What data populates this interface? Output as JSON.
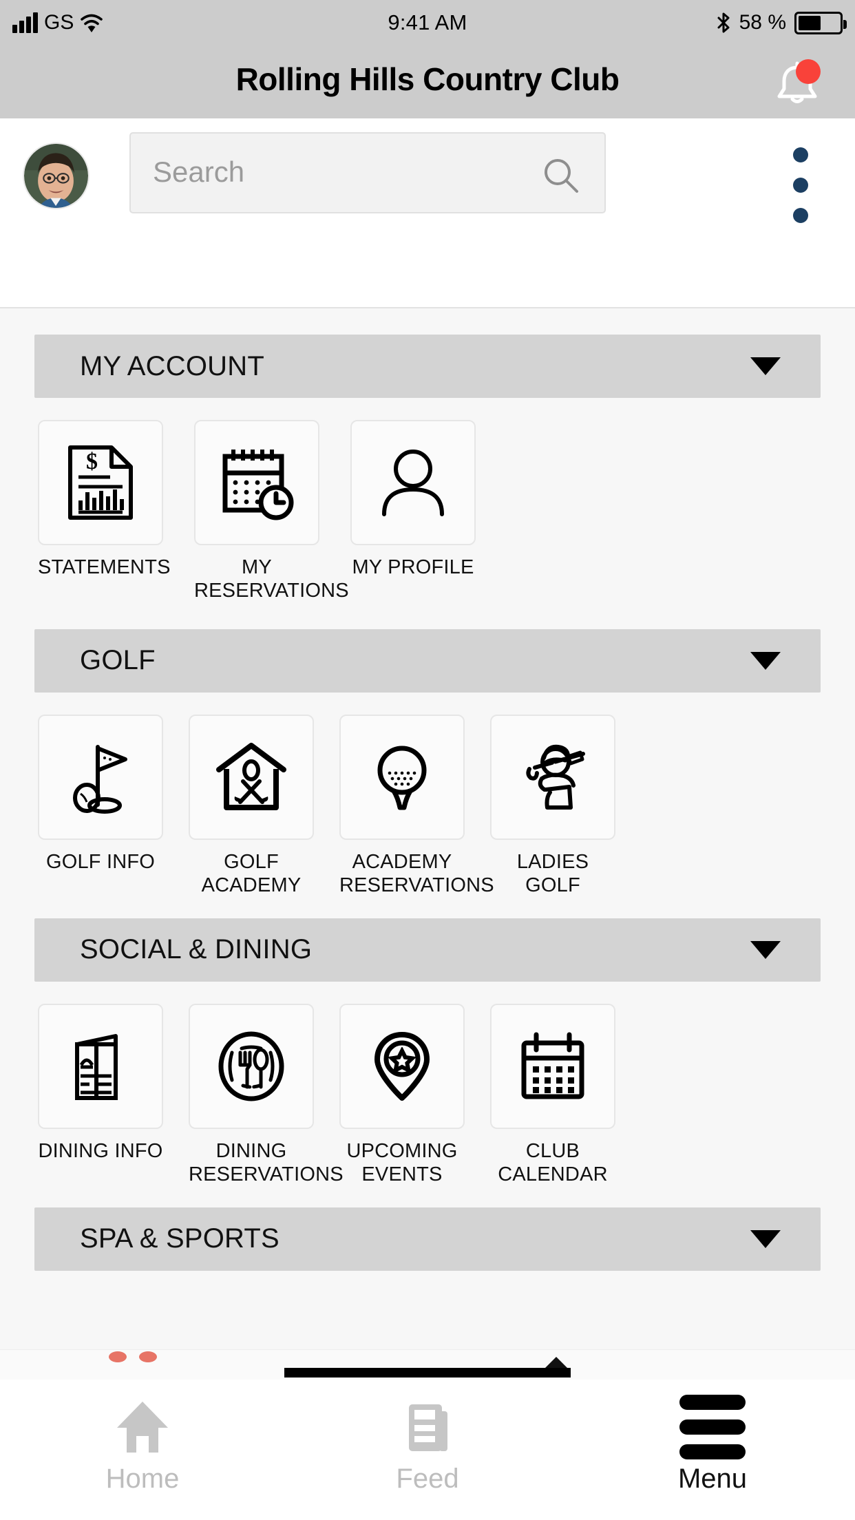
{
  "status_bar": {
    "carrier": "GS",
    "time": "9:41 AM",
    "battery_percent": "58 %",
    "signal_icon": "cellular-signal-icon",
    "wifi_icon": "wifi-icon",
    "bluetooth_icon": "bluetooth-icon",
    "battery_icon": "battery-icon"
  },
  "header": {
    "title": "Rolling Hills Country Club",
    "notification_icon": "bell-icon",
    "notification_badge_color": "#f9423a",
    "header_bg": "#cccccc"
  },
  "search": {
    "placeholder": "Search",
    "value": "",
    "search_icon": "search-icon",
    "avatar": "user-avatar",
    "overflow_icon": "kebab-menu-icon",
    "overflow_color": "#1c3f62"
  },
  "sections": [
    {
      "title": "MY ACCOUNT",
      "caret": "chevron-down-icon",
      "tiles": [
        {
          "label": "STATEMENTS",
          "icon": "document-dollar-chart-icon"
        },
        {
          "label": "MY\nRESERVATIONS",
          "icon": "calendar-clock-icon"
        },
        {
          "label": "MY PROFILE",
          "icon": "person-icon"
        }
      ]
    },
    {
      "title": "GOLF",
      "caret": "chevron-down-icon",
      "tiles": [
        {
          "label": "GOLF INFO",
          "icon": "golf-flag-hole-icon"
        },
        {
          "label": "GOLF\nACADEMY",
          "icon": "clubhouse-crossed-clubs-icon"
        },
        {
          "label": "ACADEMY\nRESERVATIONS",
          "icon": "golf-ball-tee-icon"
        },
        {
          "label": "LADIES GOLF",
          "icon": "lady-golfer-swing-icon"
        }
      ]
    },
    {
      "title": "SOCIAL & DINING",
      "caret": "chevron-down-icon",
      "tiles": [
        {
          "label": "DINING INFO",
          "icon": "menu-card-icon"
        },
        {
          "label": "DINING\nRESERVATIONS",
          "icon": "plate-fork-spoon-icon"
        },
        {
          "label": "UPCOMING\nEVENTS",
          "icon": "map-pin-star-icon"
        },
        {
          "label": "CLUB\nCALENDAR",
          "icon": "calendar-icon"
        }
      ]
    },
    {
      "title": "SPA & SPORTS",
      "caret": "chevron-down-icon",
      "tiles": []
    }
  ],
  "tabbar": {
    "items": [
      {
        "label": "Home",
        "icon": "home-icon",
        "active": false
      },
      {
        "label": "Feed",
        "icon": "feed-icon",
        "active": false
      },
      {
        "label": "Menu",
        "icon": "hamburger-menu-icon",
        "active": true
      }
    ]
  },
  "colors": {
    "section_header_bg": "#d3d3d3",
    "page_bg": "#f7f7f7",
    "accent_navy": "#1c3f62",
    "alert_red": "#f9423a"
  }
}
